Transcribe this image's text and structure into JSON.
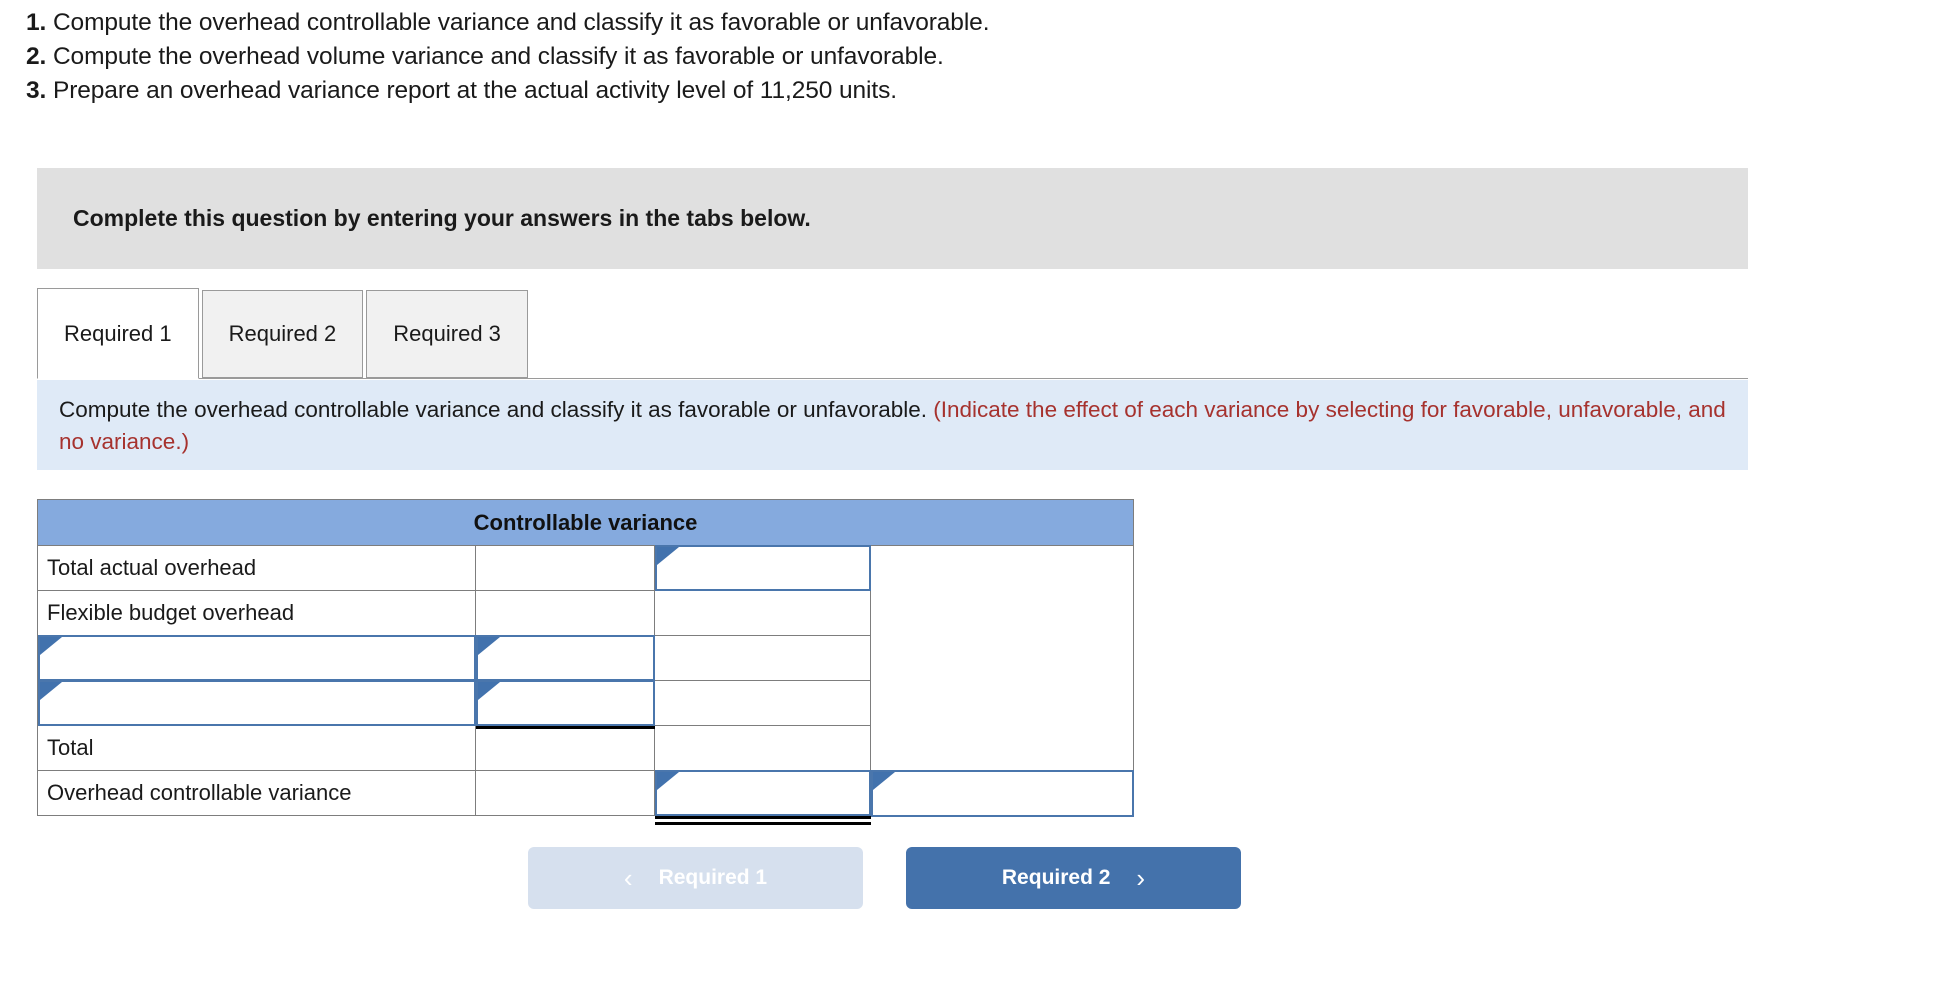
{
  "questions": [
    {
      "num": "1.",
      "text": "Compute the overhead controllable variance and classify it as favorable or unfavorable."
    },
    {
      "num": "2.",
      "text": "Compute the overhead volume variance and classify it as favorable or unfavorable."
    },
    {
      "num": "3.",
      "text": "Prepare an overhead variance report at the actual activity level of 11,250 units."
    }
  ],
  "banner": {
    "text": "Complete this question by entering your answers in the tabs below."
  },
  "tabs": [
    {
      "label": "Required 1",
      "active": true
    },
    {
      "label": "Required 2",
      "active": false
    },
    {
      "label": "Required 3",
      "active": false
    }
  ],
  "instruction": {
    "main": "Compute the overhead controllable variance and classify it as favorable or unfavorable. ",
    "hint": "(Indicate the effect of each variance by selecting for favorable, unfavorable, and no variance.)"
  },
  "table": {
    "header": "Controllable variance",
    "rows": [
      {
        "label": "Total actual overhead",
        "v1": "",
        "v2": "",
        "v3": ""
      },
      {
        "label": "Flexible budget overhead",
        "v1": "",
        "v2": "",
        "v3": ""
      },
      {
        "label": "",
        "v1": "",
        "v2": "",
        "v3": ""
      },
      {
        "label": "",
        "v1": "",
        "v2": "",
        "v3": ""
      },
      {
        "label": "Total",
        "v1": "",
        "v2": "",
        "v3": ""
      },
      {
        "label": "Overhead controllable variance",
        "v1": "",
        "v2": "",
        "v3": ""
      }
    ]
  },
  "nav": {
    "prev_label": "Required 1",
    "next_label": "Required 2",
    "prev_icon": "chevron-left-icon",
    "next_icon": "chevron-right-icon",
    "prev_chevron": "‹",
    "next_chevron": "›"
  },
  "colors": {
    "banner_bg": "#e0e0e0",
    "instruction_bg": "#dfeaf7",
    "hint_red": "#a6322e",
    "table_header_blue": "#85aade",
    "input_border_blue": "#4a76ac",
    "next_button_blue": "#4472ab",
    "prev_button_blue": "#d6e0ee"
  }
}
